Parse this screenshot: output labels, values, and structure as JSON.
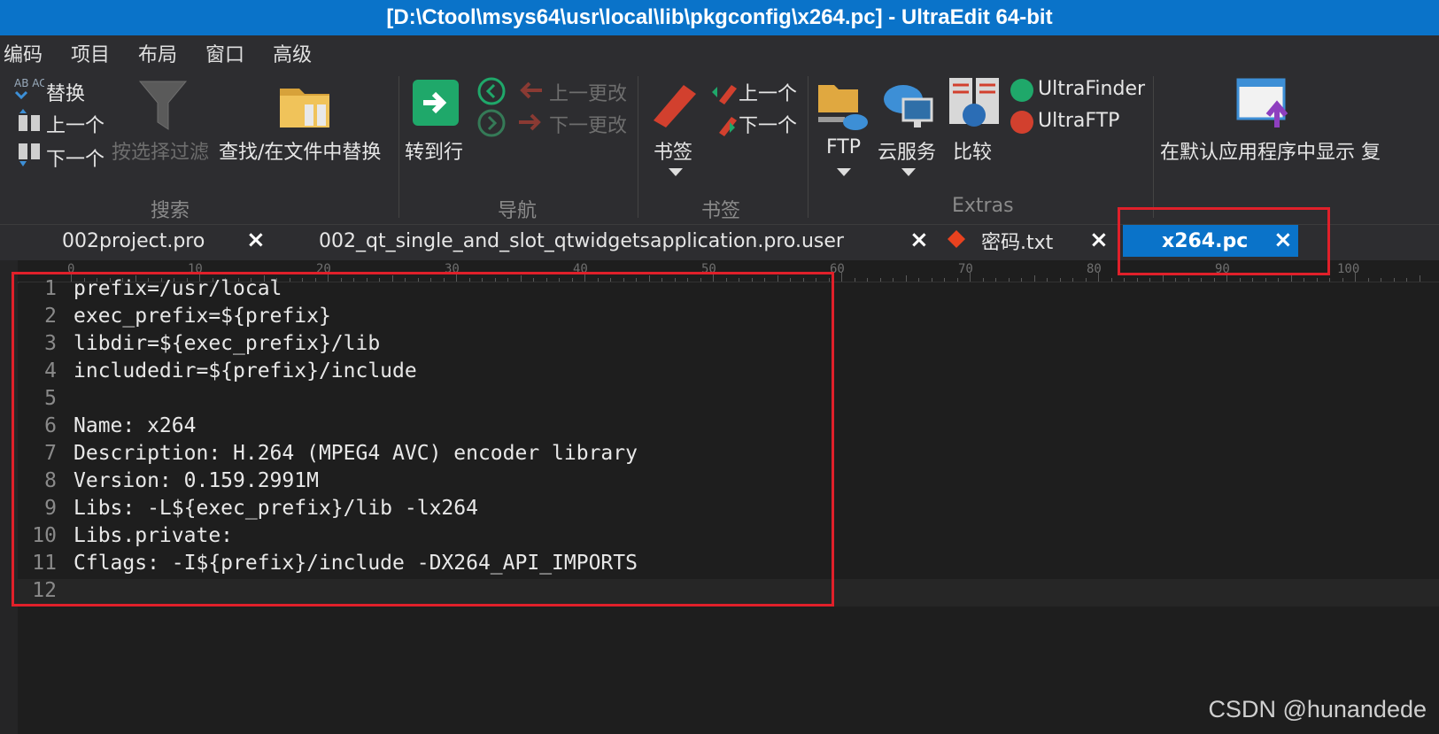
{
  "window": {
    "title": "[D:\\Ctool\\msys64\\usr\\local\\lib\\pkgconfig\\x264.pc] - UltraEdit 64-bit"
  },
  "menu": [
    "编码",
    "项目",
    "布局",
    "窗口",
    "高级"
  ],
  "ribbon": {
    "search": {
      "replace": "替换",
      "prev": "上一个",
      "next": "下一个",
      "filter": "按选择过滤",
      "find_in_files": "查找/在文件中替换",
      "label": "搜索",
      "replace_icon_text": "AB AC"
    },
    "nav": {
      "goto_line": "转到行",
      "prev_change": "上一更改",
      "next_change": "下一更改",
      "label": "导航"
    },
    "bookmark": {
      "bookmark": "书签",
      "prev": "上一个",
      "next": "下一个",
      "label": "书签"
    },
    "extras": {
      "ftp": "FTP",
      "cloud": "云服务",
      "compare": "比较",
      "ultrafinder": "UltraFinder",
      "ultraftp": "UltraFTP",
      "label": "Extras"
    },
    "show_default": "在默认应用程序中显示 复"
  },
  "tabs": [
    {
      "label": "002project.pro"
    },
    {
      "label": "002_qt_single_and_slot_qtwidgetsapplication.pro.user"
    },
    {
      "label": "密码.txt"
    },
    {
      "label": "x264.pc"
    }
  ],
  "ruler": [
    "0",
    "10",
    "20",
    "30",
    "40",
    "50",
    "60",
    "70",
    "80",
    "90",
    "100"
  ],
  "editor": {
    "lines": [
      {
        "num": "1",
        "text": "prefix=/usr/local"
      },
      {
        "num": "2",
        "text": "exec_prefix=${prefix}"
      },
      {
        "num": "3",
        "text": "libdir=${exec_prefix}/lib"
      },
      {
        "num": "4",
        "text": "includedir=${prefix}/include"
      },
      {
        "num": "5",
        "text": ""
      },
      {
        "num": "6",
        "text": "Name: x264"
      },
      {
        "num": "7",
        "text": "Description: H.264 (MPEG4 AVC) encoder library"
      },
      {
        "num": "8",
        "text": "Version: 0.159.2991M"
      },
      {
        "num": "9",
        "text": "Libs: -L${exec_prefix}/lib -lx264"
      },
      {
        "num": "10",
        "text": "Libs.private:"
      },
      {
        "num": "11",
        "text": "Cflags: -I${prefix}/include -DX264_API_IMPORTS"
      },
      {
        "num": "12",
        "text": ""
      }
    ]
  },
  "watermark": "CSDN @hunandede",
  "colors": {
    "accent": "#0a73c9",
    "highlight_box": "#e0202a",
    "editor_bg": "#1e1e1e"
  }
}
